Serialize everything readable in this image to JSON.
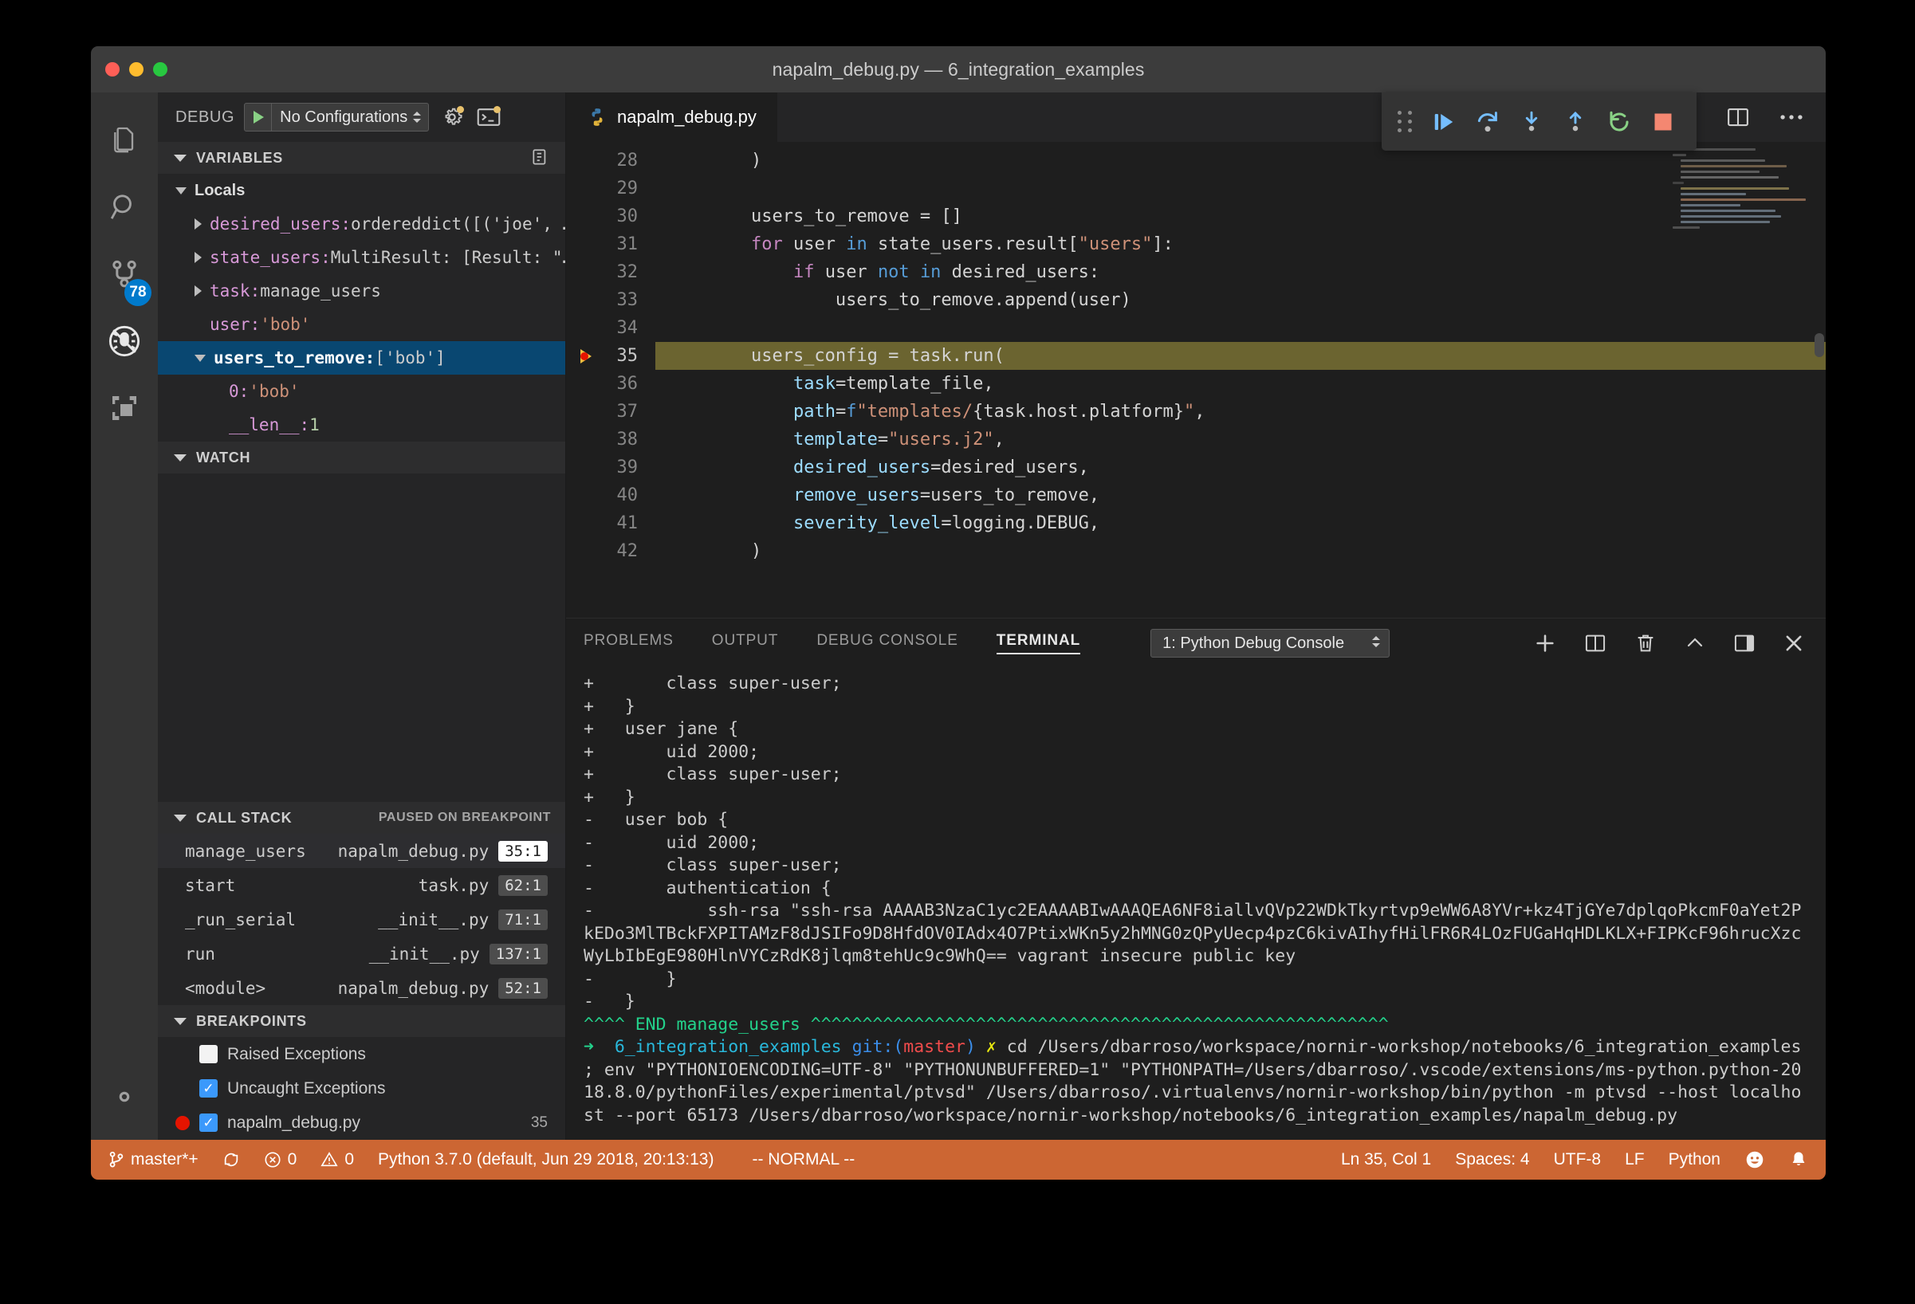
{
  "window": {
    "title": "napalm_debug.py — 6_integration_examples"
  },
  "activitybar": {
    "items": [
      {
        "name": "explorer-icon",
        "label": "Explorer"
      },
      {
        "name": "search-icon",
        "label": "Search"
      },
      {
        "name": "source-control-icon",
        "label": "Source Control",
        "badge": "78"
      },
      {
        "name": "debug-icon",
        "label": "Debug"
      },
      {
        "name": "extensions-icon",
        "label": "Extensions"
      }
    ],
    "settings_label": "Manage"
  },
  "debug_bar": {
    "label": "DEBUG",
    "configuration": "No Configurations",
    "settings_icon": "gear-icon",
    "console_icon": "open-console-icon"
  },
  "variables": {
    "header": "VARIABLES",
    "scope": "Locals",
    "rows": [
      {
        "indent": 1,
        "twisty": "right",
        "name": "desired_users:",
        "value": "ordereddict([('joe', …",
        "vtype": "plain"
      },
      {
        "indent": 1,
        "twisty": "right",
        "name": "state_users:",
        "value": "MultiResult: [Result: \"…",
        "vtype": "plain"
      },
      {
        "indent": 1,
        "twisty": "right",
        "name": "task:",
        "value": "manage_users",
        "vtype": "plain"
      },
      {
        "indent": 1,
        "twisty": "none",
        "name": "user:",
        "value": "'bob'",
        "vtype": "str"
      },
      {
        "indent": 1,
        "twisty": "down",
        "name": "users_to_remove:",
        "value": "['bob']",
        "vtype": "plain",
        "selected": true
      },
      {
        "indent": 2,
        "twisty": "none",
        "name": "0:",
        "value": "'bob'",
        "vtype": "str"
      },
      {
        "indent": 2,
        "twisty": "none",
        "name": "__len__:",
        "value": "1",
        "vtype": "num"
      }
    ]
  },
  "watch": {
    "header": "WATCH"
  },
  "call_stack": {
    "header": "CALL STACK",
    "status": "PAUSED ON BREAKPOINT",
    "rows": [
      {
        "fn": "manage_users",
        "file": "napalm_debug.py",
        "line": "35:1",
        "active": true
      },
      {
        "fn": "start",
        "file": "task.py",
        "line": "62:1",
        "active": false
      },
      {
        "fn": "_run_serial",
        "file": "__init__.py",
        "line": "71:1",
        "active": false
      },
      {
        "fn": "run",
        "file": "__init__.py",
        "line": "137:1",
        "active": false
      },
      {
        "fn": "<module>",
        "file": "napalm_debug.py",
        "line": "52:1",
        "active": false
      }
    ]
  },
  "breakpoints": {
    "header": "BREAKPOINTS",
    "rows": [
      {
        "label": "Raised Exceptions",
        "checked": false,
        "reddot": false,
        "line": ""
      },
      {
        "label": "Uncaught Exceptions",
        "checked": true,
        "reddot": false,
        "line": ""
      },
      {
        "label": "napalm_debug.py",
        "checked": true,
        "reddot": true,
        "line": "35"
      }
    ]
  },
  "editor": {
    "tab_label": "napalm_debug.py",
    "tab_icon": "python-file-icon",
    "actions": [
      {
        "name": "split-editor-right-icon"
      },
      {
        "name": "split-editor-icon"
      },
      {
        "name": "more-actions-icon"
      }
    ],
    "first_line": 28,
    "highlight_line": 35,
    "breakpoint_line": 35,
    "lines": [
      {
        "n": 28,
        "tokens": [
          {
            "t": "        )",
            "c": ""
          }
        ]
      },
      {
        "n": 29,
        "tokens": [
          {
            "t": "",
            "c": ""
          }
        ]
      },
      {
        "n": 30,
        "tokens": [
          {
            "t": "        users_to_remove = []",
            "c": ""
          }
        ]
      },
      {
        "n": 31,
        "tokens": [
          {
            "t": "        ",
            "c": ""
          },
          {
            "t": "for",
            "c": "k-ctl"
          },
          {
            "t": " user ",
            "c": ""
          },
          {
            "t": "in",
            "c": "k-op"
          },
          {
            "t": " state_users.result[",
            "c": ""
          },
          {
            "t": "\"users\"",
            "c": "k-str"
          },
          {
            "t": "]:",
            "c": ""
          }
        ]
      },
      {
        "n": 32,
        "tokens": [
          {
            "t": "            ",
            "c": ""
          },
          {
            "t": "if",
            "c": "k-ctl"
          },
          {
            "t": " user ",
            "c": ""
          },
          {
            "t": "not",
            "c": "k-op"
          },
          {
            "t": " ",
            "c": ""
          },
          {
            "t": "in",
            "c": "k-op"
          },
          {
            "t": " desired_users:",
            "c": ""
          }
        ]
      },
      {
        "n": 33,
        "tokens": [
          {
            "t": "                users_to_remove.append(user)",
            "c": ""
          }
        ]
      },
      {
        "n": 34,
        "tokens": [
          {
            "t": "",
            "c": ""
          }
        ]
      },
      {
        "n": 35,
        "tokens": [
          {
            "t": "        users_config = task.run(",
            "c": ""
          }
        ]
      },
      {
        "n": 36,
        "tokens": [
          {
            "t": "            ",
            "c": ""
          },
          {
            "t": "task",
            "c": "k-par"
          },
          {
            "t": "=template_file,",
            "c": ""
          }
        ]
      },
      {
        "n": 37,
        "tokens": [
          {
            "t": "            ",
            "c": ""
          },
          {
            "t": "path",
            "c": "k-par"
          },
          {
            "t": "=",
            "c": ""
          },
          {
            "t": "f",
            "c": "k-op"
          },
          {
            "t": "\"templates/",
            "c": "k-str"
          },
          {
            "t": "{task.host.platform}",
            "c": ""
          },
          {
            "t": "\"",
            "c": "k-str"
          },
          {
            "t": ",",
            "c": ""
          }
        ]
      },
      {
        "n": 38,
        "tokens": [
          {
            "t": "            ",
            "c": ""
          },
          {
            "t": "template",
            "c": "k-par"
          },
          {
            "t": "=",
            "c": ""
          },
          {
            "t": "\"users.j2\"",
            "c": "k-str"
          },
          {
            "t": ",",
            "c": ""
          }
        ]
      },
      {
        "n": 39,
        "tokens": [
          {
            "t": "            ",
            "c": ""
          },
          {
            "t": "desired_users",
            "c": "k-par"
          },
          {
            "t": "=desired_users,",
            "c": ""
          }
        ]
      },
      {
        "n": 40,
        "tokens": [
          {
            "t": "            ",
            "c": ""
          },
          {
            "t": "remove_users",
            "c": "k-par"
          },
          {
            "t": "=users_to_remove,",
            "c": ""
          }
        ]
      },
      {
        "n": 41,
        "tokens": [
          {
            "t": "            ",
            "c": ""
          },
          {
            "t": "severity_level",
            "c": "k-par"
          },
          {
            "t": "=logging.DEBUG,",
            "c": ""
          }
        ]
      },
      {
        "n": 42,
        "tokens": [
          {
            "t": "        )",
            "c": ""
          }
        ]
      }
    ]
  },
  "debug_toolbar": {
    "buttons": [
      {
        "name": "drag-handle-icon",
        "label": "Drag"
      },
      {
        "name": "continue-icon",
        "label": "Continue"
      },
      {
        "name": "step-over-icon",
        "label": "Step Over"
      },
      {
        "name": "step-into-icon",
        "label": "Step Into"
      },
      {
        "name": "step-out-icon",
        "label": "Step Out"
      },
      {
        "name": "restart-icon",
        "label": "Restart"
      },
      {
        "name": "stop-icon",
        "label": "Stop"
      }
    ]
  },
  "panel": {
    "tabs": [
      {
        "label": "PROBLEMS",
        "active": false
      },
      {
        "label": "OUTPUT",
        "active": false
      },
      {
        "label": "DEBUG CONSOLE",
        "active": false
      },
      {
        "label": "TERMINAL",
        "active": true
      }
    ],
    "select_value": "1: Python Debug Console",
    "actions": [
      {
        "name": "new-terminal-icon"
      },
      {
        "name": "split-terminal-icon"
      },
      {
        "name": "kill-terminal-icon"
      },
      {
        "name": "maximize-panel-icon"
      },
      {
        "name": "toggle-sidebar-icon"
      },
      {
        "name": "close-panel-icon"
      }
    ],
    "terminal_lines": [
      {
        "segments": [
          {
            "t": "+       class super-user;",
            "c": ""
          }
        ]
      },
      {
        "segments": [
          {
            "t": "+   }",
            "c": ""
          }
        ]
      },
      {
        "segments": [
          {
            "t": "+   user jane {",
            "c": ""
          }
        ]
      },
      {
        "segments": [
          {
            "t": "+       uid 2000;",
            "c": ""
          }
        ]
      },
      {
        "segments": [
          {
            "t": "+       class super-user;",
            "c": ""
          }
        ]
      },
      {
        "segments": [
          {
            "t": "+   }",
            "c": ""
          }
        ]
      },
      {
        "segments": [
          {
            "t": "-   user bob {",
            "c": ""
          }
        ]
      },
      {
        "segments": [
          {
            "t": "-       uid 2000;",
            "c": ""
          }
        ]
      },
      {
        "segments": [
          {
            "t": "-       class super-user;",
            "c": ""
          }
        ]
      },
      {
        "segments": [
          {
            "t": "-       authentication {",
            "c": ""
          }
        ]
      },
      {
        "segments": [
          {
            "t": "-           ssh-rsa \"ssh-rsa AAAAB3NzaC1yc2EAAAABIwAAAQEA6NF8iallvQVp22WDkTkyrtvp9eWW6A8YVr+kz4TjGYe7dplqoPkcmF0aYet2PkEDo3MlTBckFXPITAMzF8dJSIFo9D8HfdOV0IAdx4O7PtixWKn5y2hMNG0zQPyUecp4pzC6kivAIhyfHilFR6R4LOzFUGaHqHDLKLX+FIPKcF96hrucXzcWyLbIbEgE980HlnVYCzRdK8jlqm8tehUc9c9WhQ== vagrant insecure public key",
            "c": ""
          }
        ]
      },
      {
        "segments": [
          {
            "t": "-       }",
            "c": ""
          }
        ]
      },
      {
        "segments": [
          {
            "t": "-   }",
            "c": ""
          }
        ]
      },
      {
        "segments": [
          {
            "t": "^^^^ END manage_users ^^^^^^^^^^^^^^^^^^^^^^^^^^^^^^^^^^^^^^^^^^^^^^^^^^^^^^^^",
            "c": "t-green"
          }
        ]
      },
      {
        "segments": [
          {
            "t": "➜  ",
            "c": "t-green"
          },
          {
            "t": "6_integration_examples ",
            "c": "t-cyan"
          },
          {
            "t": "git:(",
            "c": "t-blue"
          },
          {
            "t": "master",
            "c": "t-red"
          },
          {
            "t": ") ",
            "c": "t-blue"
          },
          {
            "t": "✗ ",
            "c": "t-yellow"
          },
          {
            "t": "cd /Users/dbarroso/workspace/nornir-workshop/notebooks/6_integration_examples ; env \"PYTHONIOENCODING=UTF-8\" \"PYTHONUNBUFFERED=1\" \"PYTHONPATH=/Users/dbarroso/.vscode/extensions/ms-python.python-2018.8.0/pythonFiles/experimental/ptvsd\" /Users/dbarroso/.virtualenvs/nornir-workshop/bin/python -m ptvsd --host localhost --port 65173 /Users/dbarroso/workspace/nornir-workshop/notebooks/6_integration_examples/napalm_debug.py",
            "c": ""
          }
        ]
      }
    ]
  },
  "statusbar": {
    "branch": "master*+",
    "sync_icon": "sync-icon",
    "errors": "0",
    "warnings": "0",
    "interpreter": "Python 3.7.0 (default, Jun 29 2018, 20:13:13)",
    "mode": "-- NORMAL --",
    "position": "Ln 35, Col 1",
    "indentation": "Spaces: 4",
    "encoding": "UTF-8",
    "eol": "LF",
    "language": "Python",
    "feedback_icon": "smiley-icon",
    "bell_icon": "bell-icon",
    "background": "#cc6633"
  }
}
